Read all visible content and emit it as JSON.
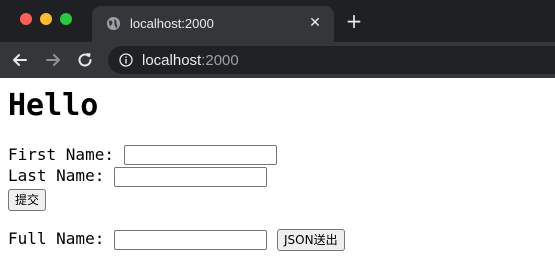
{
  "browser": {
    "tab": {
      "title": "localhost:2000",
      "icon": "globe-icon",
      "close_label": "✕"
    },
    "new_tab_label": "+",
    "toolbar": {
      "back_icon": "back-arrow-icon",
      "forward_icon": "forward-arrow-icon",
      "reload_icon": "reload-icon",
      "info_icon": "info-icon"
    },
    "address": {
      "host": "localhost",
      "port": ":2000"
    },
    "colors": {
      "tab_strip": "#1f2023",
      "tab": "#35363a",
      "omnibox": "#202124",
      "text": "#e8eaed"
    }
  },
  "page": {
    "heading": "Hello",
    "first_name": {
      "label": "First Name: ",
      "value": ""
    },
    "last_name": {
      "label": "Last Name: ",
      "value": ""
    },
    "submit_label": "提交",
    "full_name": {
      "label": "Full Name: ",
      "value": ""
    },
    "json_button_label": "JSON送出"
  }
}
